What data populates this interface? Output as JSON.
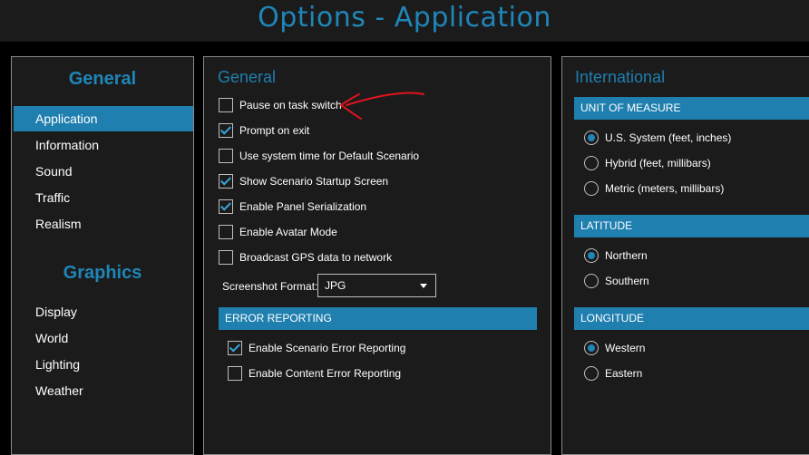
{
  "window": {
    "title": "Options - Application"
  },
  "sidebar": {
    "general_heading": "General",
    "general_items": [
      {
        "label": "Application",
        "active": true
      },
      {
        "label": "Information"
      },
      {
        "label": "Sound"
      },
      {
        "label": "Traffic"
      },
      {
        "label": "Realism"
      }
    ],
    "graphics_heading": "Graphics",
    "graphics_items": [
      {
        "label": "Display"
      },
      {
        "label": "World"
      },
      {
        "label": "Lighting"
      },
      {
        "label": "Weather"
      }
    ]
  },
  "general": {
    "title": "General",
    "options": [
      {
        "label": "Pause on task switch",
        "checked": false
      },
      {
        "label": "Prompt on exit",
        "checked": true
      },
      {
        "label": "Use system time for Default Scenario",
        "checked": false
      },
      {
        "label": "Show Scenario Startup Screen",
        "checked": true
      },
      {
        "label": "Enable Panel Serialization",
        "checked": true
      },
      {
        "label": "Enable Avatar Mode",
        "checked": false
      },
      {
        "label": "Broadcast GPS data to network",
        "checked": false
      }
    ],
    "screenshot_format_label": "Screenshot Format:",
    "screenshot_format_value": "JPG",
    "error_reporting": {
      "title": "ERROR REPORTING",
      "options": [
        {
          "label": "Enable Scenario Error Reporting",
          "checked": true
        },
        {
          "label": "Enable Content Error Reporting",
          "checked": false
        }
      ]
    }
  },
  "international": {
    "title": "International",
    "unit_of_measure": {
      "title": "UNIT OF MEASURE",
      "options": [
        {
          "label": "U.S. System (feet, inches)",
          "selected": true
        },
        {
          "label": "Hybrid (feet, millibars)",
          "selected": false
        },
        {
          "label": "Metric (meters, millibars)",
          "selected": false
        }
      ]
    },
    "latitude": {
      "title": "LATITUDE",
      "options": [
        {
          "label": "Northern",
          "selected": true
        },
        {
          "label": "Southern",
          "selected": false
        }
      ]
    },
    "longitude": {
      "title": "LONGITUDE",
      "options": [
        {
          "label": "Western",
          "selected": true
        },
        {
          "label": "Eastern",
          "selected": false
        }
      ]
    }
  },
  "colors": {
    "accent": "#1f7fae",
    "title_blue": "#1f86b8",
    "panel_bg": "#1b1b1b",
    "annotation": "#e0141e"
  }
}
